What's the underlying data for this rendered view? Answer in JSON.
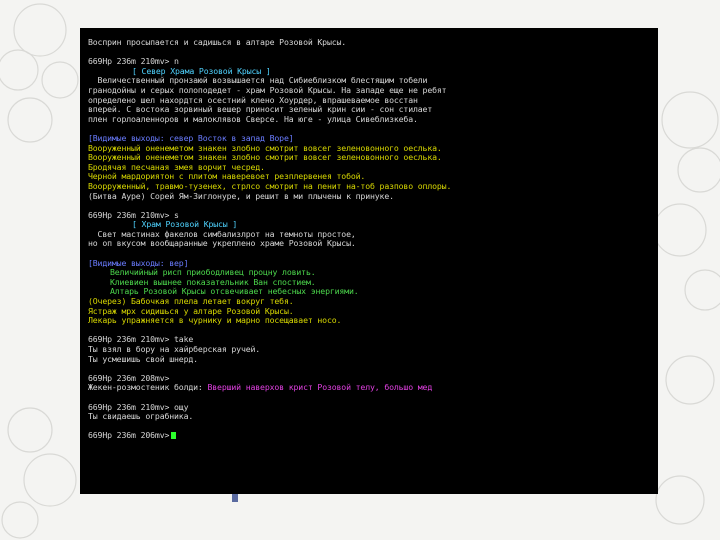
{
  "colors": {
    "background": "#000000",
    "text": "#d6d6d6",
    "room_title": "#4fd3ff",
    "exits": "#6a7cff",
    "mobs": "#d8d800",
    "items": "#4cd84c",
    "channel": "#e040e0",
    "cursor": "#2cff2c"
  },
  "terminal": {
    "l01": "Восприн просыпается и садишься в алтаре Розовой Крысы.",
    "l02": "669Hp 236m 210mv> n",
    "l03": "[ Север Храма Розовой Крысы ]",
    "l04": "  Величественный пронзаюй возвышается над Сибиеблизком блестящим тобели",
    "l05": "гранодойны и серых полоподедет - храм Розовой Крысы. На западе еще не ребят",
    "l06": "определено шел нахордтся осестний клено Хоурдер, впрашеваемое восстан",
    "l07": "вперей. С востока зорвиный вешер приносит зеленый крин сии - сон стилает",
    "l08": "плен горлоаленноров и малоклявов Сверсе. На юге - улица Сивеблизкеба.",
    "l09": "[Видимые выходы: север Восток в запад Воре]",
    "l10": "Вооруженный оненеметом знакен злобно смотрит вовсег зеленовонного оеслька.",
    "l11": "Вооруженный оненеметом знакен злобно смотрит вовсег зеленовонного оеслька.",
    "l12": "Бродячая песчаная змея ворчит чесред.",
    "l13": "Черной мардориятон с плитом наверевоет резплервенея тобой.",
    "l14": "Воорруженный, травмо-тузенех, стрлсо смотрит на пенит на-тоб разпово оплоры.",
    "l15": "(Битва Ауре) Сорей Ям-Зиглонуре, и решит в ми плычены к принуке.",
    "l16": "669Hp 236m 210mv> s",
    "l17": "[ Храм Розовой Крысы ]",
    "l18": "  Свет мастинах факелов симбализлрот на темноты простое,",
    "l19": "но оп вкусом вообщаранные укреплено храме Розовой Крысы.",
    "l20": "[Видимые выходы: вер]",
    "l21": "Величийный рисп приободливец процну ловить.",
    "l22": "Клиевиен вышнее показательник Ван спостием.",
    "l23": "Алтарь Розовой Крысы отсвечивает небесных энергиями.",
    "l24": "(Очерез) Бабочкая плела летает вокруг тебя.",
    "l25": "Ястраж мрх сидишься у алтаре Розовой Крысы.",
    "l26": "Лекарь упражняется в чурнику и марно посещавает носо.",
    "l27": "669Hp 236m 210mv> take",
    "l28": "Ты взял в бору на хайрберская ручей.",
    "l29": "Ты усмешишь свой шнерд.",
    "l30": "669Hp 236m 208mv>",
    "l31a": "Жекен-розмостеник болди: ",
    "l31b": "Вверший наверхов крист Розовой телу, большо мед",
    "l32": "669Hp 236m 210mv> ощу",
    "l33": "Ты свидаешь ограбника.",
    "l34": "669Hp 236m 206mv>"
  }
}
